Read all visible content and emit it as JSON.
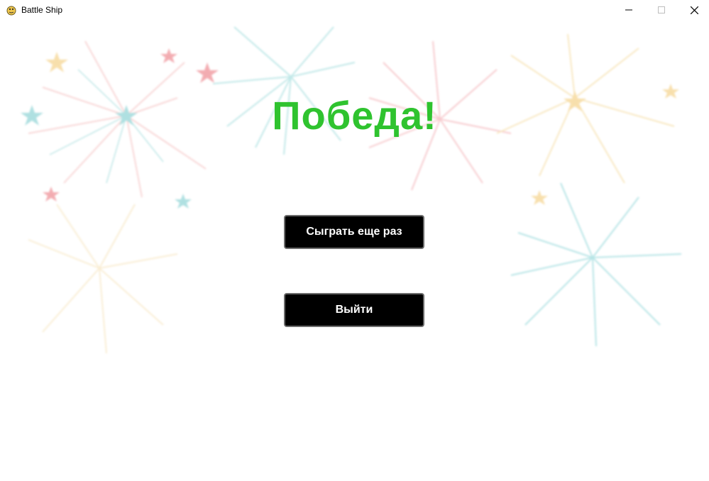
{
  "window": {
    "title": "Battle Ship",
    "icon": "pygame-snake-icon",
    "controls": [
      "minimize-icon",
      "maximize-icon",
      "close-icon"
    ]
  },
  "screen": {
    "headline": "Победа!",
    "headline_color": "#2fc32f",
    "background": "fireworks-illustration",
    "buttons": {
      "play_again": "Сыграть еще раз",
      "quit": "Выйти"
    }
  },
  "colors": {
    "button_bg": "#000000",
    "button_border": "#6b6b6b",
    "button_text": "#ffffff"
  }
}
